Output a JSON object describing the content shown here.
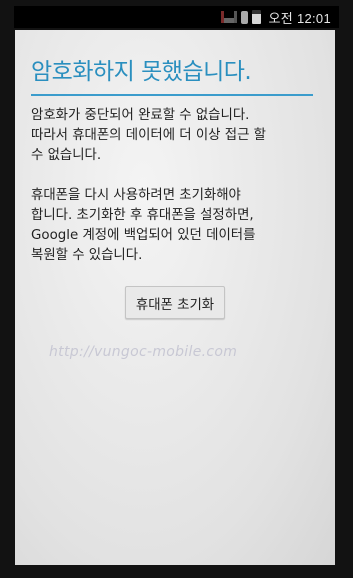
{
  "status_bar": {
    "time": "오전 12:01",
    "icons": [
      "signal-icon",
      "lock-icon",
      "battery-icon"
    ]
  },
  "dialog": {
    "title": "암호화하지 못했습니다.",
    "paragraph_1": "암호화가 중단되어 완료할 수 없습니다.\n따라서 휴대폰의 데이터에 더 이상 접근 할\n수 없습니다.",
    "paragraph_2": "휴대폰을 다시 사용하려면 초기화해야\n합니다. 초기화한 후 휴대폰을 설정하면,\nGoogle 계정에 백업되어 있던 데이터를\n복원할 수 있습니다.",
    "reset_button_label": "휴대폰 초기화",
    "accent_color": "#2a8fbf"
  },
  "watermark": "http://vungoc-mobile.com"
}
